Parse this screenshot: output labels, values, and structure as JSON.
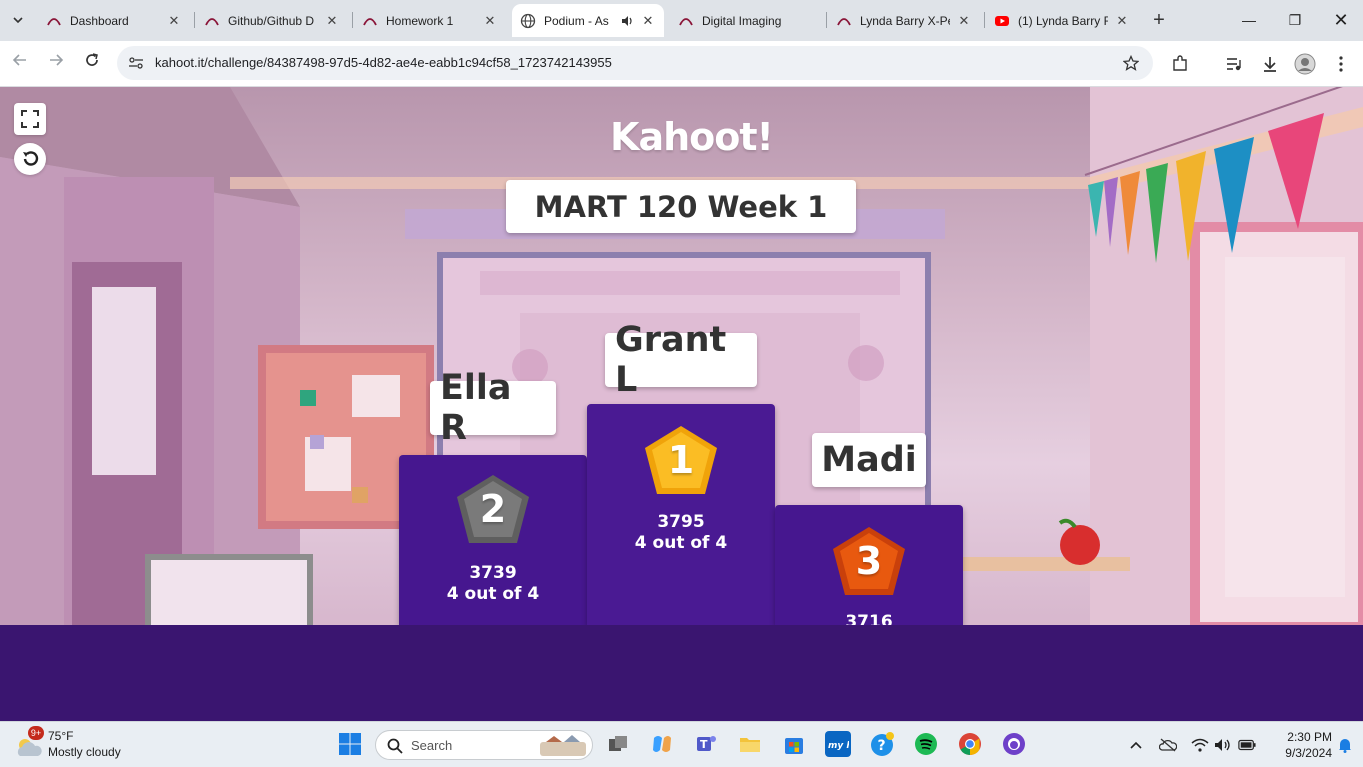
{
  "browser": {
    "tabs": [
      {
        "title": "Dashboard",
        "active": false
      },
      {
        "title": "Github/Github D",
        "active": false
      },
      {
        "title": "Homework 1",
        "active": false
      },
      {
        "title": "Podium - As",
        "active": true
      },
      {
        "title": "Digital Imaging",
        "active": false
      },
      {
        "title": "Lynda Barry X-Pe",
        "active": false
      },
      {
        "title": "(1) Lynda Barry F",
        "active": false
      }
    ],
    "url": "kahoot.it/challenge/84387498-97d5-4d82-ae4e-eabb1c94cf58_1723742143955"
  },
  "kahoot": {
    "logo": "Kahoot!",
    "quiz_title": "MART 120 Week 1",
    "podium": [
      {
        "rank": "1",
        "name": "Grant L",
        "score": "3795",
        "correct": "4 out of 4",
        "color": "#f5a623"
      },
      {
        "rank": "2",
        "name": "Ella R",
        "score": "3739",
        "correct": "4 out of 4",
        "color": "#6e6e6e"
      },
      {
        "rank": "3",
        "name": "Madi",
        "score": "3716",
        "correct": "",
        "color": "#e84d0e"
      }
    ]
  },
  "taskbar": {
    "weather_badge": "9+",
    "temperature": "75°F",
    "condition": "Mostly cloudy",
    "search_placeholder": "Search",
    "time": "2:30 PM",
    "date": "9/3/2024"
  }
}
